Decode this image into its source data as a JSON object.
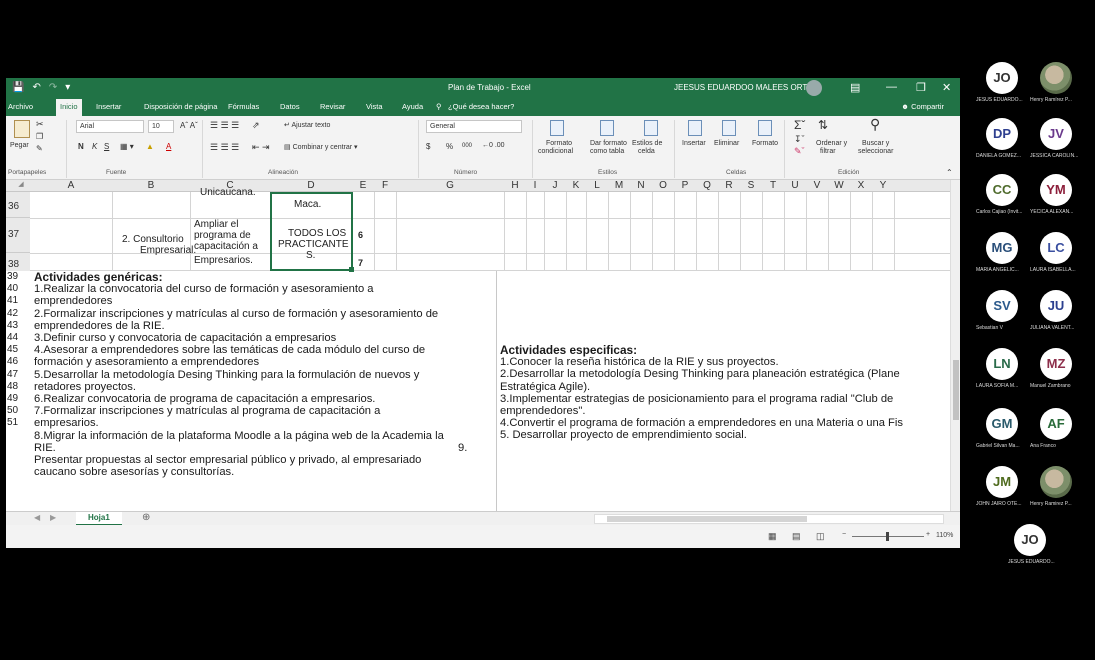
{
  "excel": {
    "title": "Plan de Trabajo - Excel",
    "user": "JEESUS EDUARDOO MALEES ORTIZ",
    "tabs": [
      "Archivo",
      "Inicio",
      "Insertar",
      "Disposición de página",
      "Fórmulas",
      "Datos",
      "Revisar",
      "Vista",
      "Ayuda"
    ],
    "tell_me": "¿Qué desea hacer?",
    "share": "Compartir",
    "ribbon": {
      "paste": "Pegar",
      "font_name": "Arial",
      "font_size": "10",
      "bold": "N",
      "italic": "K",
      "underline": "S",
      "wrap_text": "Ajustar texto",
      "merge": "Combinar y centrar",
      "number_format": "General",
      "currency": "$",
      "percent": "%",
      "thousands": "000",
      "cond_format_1": "Formato",
      "cond_format_2": "condicional",
      "table_format_1": "Dar formato",
      "table_format_2": "como tabla",
      "cell_styles_1": "Estilos de",
      "cell_styles_2": "celda",
      "insert": "Insertar",
      "delete": "Eliminar",
      "format": "Formato",
      "sort_1": "Ordenar y",
      "sort_2": "filtrar",
      "find_1": "Buscar y",
      "find_2": "seleccionar",
      "groups": [
        "Portapapeles",
        "Fuente",
        "Alineación",
        "Número",
        "Estilos",
        "Celdas",
        "Edición"
      ]
    },
    "columns": [
      "A",
      "B",
      "C",
      "D",
      "E",
      "F",
      "G",
      "H",
      "I",
      "J",
      "K",
      "L",
      "M",
      "N",
      "O",
      "P",
      "Q",
      "R",
      "S",
      "T",
      "U",
      "V",
      "W",
      "X",
      "Y"
    ],
    "rows": [
      "36",
      "37",
      "38",
      "39",
      "40",
      "41",
      "42",
      "43",
      "44",
      "45",
      "46",
      "47",
      "48",
      "49",
      "50",
      "51"
    ],
    "cells": {
      "c36_top": "Unicaucana.",
      "d36": "Maca.",
      "b37_1": "2.  Consultorio",
      "b37_2": "Empresarial.",
      "c37_1": "Ampliar el",
      "c37_2": "programa de",
      "c37_3": "capacitación a",
      "c37_4": "Empresarios.",
      "d37_1": "TODOS LOS",
      "d37_2": "PRACTICANTE",
      "d37_3": "S.",
      "e37": "6",
      "e38": "7"
    },
    "generic": {
      "heading": "Actividades genéricas:",
      "lines": [
        "1.Realizar la convocatoria del curso de formación y asesoramiento a",
        "emprendedores",
        "2.Formalizar inscripciones y matrículas al curso de formación y asesoramiento de",
        "emprendedores de la RIE.",
        "3.Definir curso y convocatoria de capacitación a empresarios",
        "4.Asesorar a emprendedores sobre las temáticas de cada módulo del curso de",
        "formación y asesoramiento a emprendedores",
        "5.Desarrollar la metodología Desing Thinking para la formulación de nuevos y",
        "retadores proyectos.",
        "6.Realizar convocatoria de programa de capacitación a empresarios.",
        "7.Formalizar inscripciones y matrículas al programa de capacitación a",
        "empresarios.",
        "8.Migrar la información de la plataforma Moodle a la página web de la Academia la",
        "RIE.",
        "Presentar propuestas al sector empresarial público y privado, al empresariado",
        "caucano sobre asesorías y consultorías."
      ],
      "item9": "9."
    },
    "specific": {
      "heading": "Actividades especificas:",
      "lines": [
        "1.Conocer la reseña histórica de la RIE y sus proyectos.",
        "2.Desarrollar la metodología Desing Thinking para planeación estratégica (Plane",
        "Estratégica Agile).",
        "3.Implementar estrategias de posicionamiento para el programa radial \"Club de",
        "emprendedores\".",
        "4.Convertir el programa de formación a emprendedores en una Materia o una Fis",
        "5. Desarrollar proyecto de emprendimiento social."
      ]
    },
    "sheet_tab": "Hoja1",
    "zoom": "110%"
  },
  "participants": [
    {
      "initials": "JO",
      "name": "JESUS EDUARDO...",
      "color": "#ffffff",
      "text": "#333333"
    },
    {
      "initials": "",
      "name": "Henry Ramírez P...",
      "photo": true
    },
    {
      "initials": "DP",
      "name": "DANIELA GOMEZ...",
      "color": "#ffffff",
      "text": "#2e3f8f"
    },
    {
      "initials": "JV",
      "name": "JESSICA CAROLIN...",
      "color": "#ffffff",
      "text": "#6b3a8c"
    },
    {
      "initials": "CC",
      "name": "Carlos Cajiao (Invit...",
      "color": "#ffffff",
      "text": "#4f6b2c"
    },
    {
      "initials": "YM",
      "name": "YECICA ALEXAN...",
      "color": "#ffffff",
      "text": "#8c1e3a"
    },
    {
      "initials": "MG",
      "name": "MARIA ANGELIC...",
      "color": "#ffffff",
      "text": "#2a4f7a"
    },
    {
      "initials": "LC",
      "name": "LAURA ISABELLA...",
      "color": "#ffffff",
      "text": "#3a4fa0"
    },
    {
      "initials": "SV",
      "name": "Sebastian V",
      "color": "#ffffff",
      "text": "#2b5a8c"
    },
    {
      "initials": "JU",
      "name": "JULIANA VALENT...",
      "color": "#ffffff",
      "text": "#2b3f8f"
    },
    {
      "initials": "LN",
      "name": "LAURA SOFIA M...",
      "color": "#ffffff",
      "text": "#2a6b4a"
    },
    {
      "initials": "MZ",
      "name": "Manuel Zambrano",
      "color": "#ffffff",
      "text": "#8c2e4a"
    },
    {
      "initials": "GM",
      "name": "Gabriel Silvan Ma...",
      "color": "#ffffff",
      "text": "#2a5a6b"
    },
    {
      "initials": "AF",
      "name": "Ana Franco",
      "color": "#ffffff",
      "text": "#2a6b3a"
    },
    {
      "initials": "JM",
      "name": "JOHN JAIRO OTE...",
      "color": "#ffffff",
      "text": "#4f6b1e"
    },
    {
      "initials": "",
      "name": "Henry Ramirez P...",
      "photo": true
    },
    {
      "initials": "JO",
      "name": "JESUS EDUARDO...",
      "color": "#ffffff",
      "text": "#333333"
    }
  ]
}
